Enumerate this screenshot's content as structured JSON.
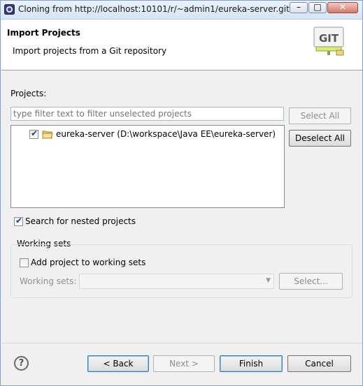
{
  "window": {
    "title": "Cloning from http://localhost:10101/r/~admin1/eureka-server.git",
    "buttons": {
      "minimize": "–",
      "maximize": "□",
      "close": "✕"
    }
  },
  "header": {
    "title": "Import Projects",
    "description": "Import projects from a Git repository",
    "logo_text": "GIT"
  },
  "projects": {
    "label": "Projects:",
    "filter_placeholder": "type filter text to filter unselected projects",
    "select_all": "Select All",
    "deselect_all": "Deselect All",
    "items": [
      {
        "label": "eureka-server (D:\\workspace\\Java EE\\eureka-server)",
        "checked": true
      }
    ]
  },
  "options": {
    "nested_label": "Search for nested projects",
    "nested_checked": true
  },
  "working_sets": {
    "group_label": "Working sets",
    "add_label": "Add project to working sets",
    "add_checked": false,
    "sets_label": "Working sets:",
    "sets_value": "",
    "select_button": "Select..."
  },
  "footer": {
    "help": "?",
    "back": "< Back",
    "next": "Next >",
    "finish": "Finish",
    "cancel": "Cancel"
  }
}
